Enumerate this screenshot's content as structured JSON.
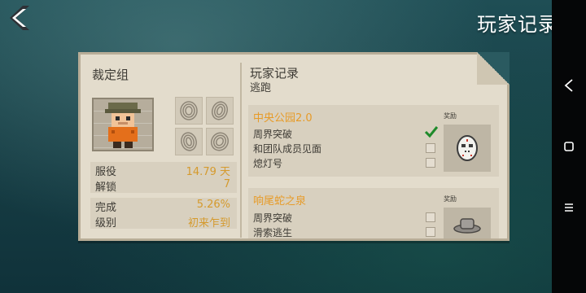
{
  "header": {
    "back_icon": "chevron-left-icon",
    "title": "玩家记录"
  },
  "left_panel": {
    "title": "裁定组",
    "stats": [
      {
        "label": "服役",
        "value": "14.79 天"
      },
      {
        "label": "解锁",
        "value": "7"
      },
      {
        "label": "完成",
        "value": "5.26%"
      },
      {
        "label": "级别",
        "value": "初来乍到"
      }
    ]
  },
  "right_panel": {
    "title": "玩家记录",
    "subtitle": "逃跑",
    "reward_label": "奖励",
    "records": [
      {
        "title": "中央公园2.0",
        "tasks": [
          {
            "label": "周界突破",
            "checked": true
          },
          {
            "label": "和团队成员见面",
            "checked": false
          },
          {
            "label": "熄灯号",
            "checked": false
          }
        ],
        "reward_icon": "hockey-mask-icon"
      },
      {
        "title": "响尾蛇之泉",
        "tasks": [
          {
            "label": "周界突破",
            "checked": false
          },
          {
            "label": "滑索逃生",
            "checked": false
          }
        ],
        "reward_icon": "cowboy-hat-icon"
      }
    ]
  },
  "system_nav": {
    "back": "back-triangle-icon",
    "home": "home-square-icon",
    "menu": "menu-lines-icon"
  },
  "colors": {
    "accent_orange": "#e79b28",
    "value_orange": "#d59a2d",
    "paper": "#e3dccc",
    "check_green": "#1e8a2a"
  }
}
